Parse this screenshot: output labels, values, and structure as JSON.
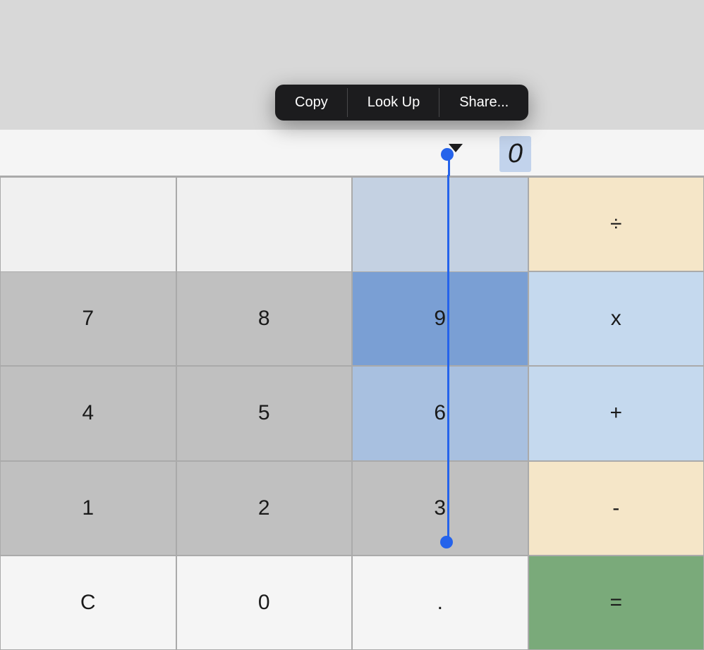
{
  "contextMenu": {
    "items": [
      {
        "id": "copy",
        "label": "Copy"
      },
      {
        "id": "lookup",
        "label": "Look Up"
      },
      {
        "id": "share",
        "label": "Share..."
      }
    ]
  },
  "display": {
    "value": "0"
  },
  "calculator": {
    "rows": [
      [
        {
          "id": "7",
          "label": "7",
          "type": "number"
        },
        {
          "id": "8",
          "label": "8",
          "type": "number"
        },
        {
          "id": "9",
          "label": "9",
          "type": "selected"
        },
        {
          "id": "multiply",
          "label": "x",
          "type": "operator-selected"
        }
      ],
      [
        {
          "id": "4",
          "label": "4",
          "type": "number"
        },
        {
          "id": "5",
          "label": "5",
          "type": "number"
        },
        {
          "id": "6",
          "label": "6",
          "type": "selected-light"
        },
        {
          "id": "add",
          "label": "+",
          "type": "operator-selected"
        }
      ],
      [
        {
          "id": "1",
          "label": "1",
          "type": "number"
        },
        {
          "id": "2",
          "label": "2",
          "type": "number"
        },
        {
          "id": "3",
          "label": "3",
          "type": "number"
        },
        {
          "id": "subtract",
          "label": "-",
          "type": "operator"
        }
      ],
      [
        {
          "id": "clear",
          "label": "C",
          "type": "white"
        },
        {
          "id": "0",
          "label": "0",
          "type": "white"
        },
        {
          "id": "decimal",
          "label": ".",
          "type": "white"
        },
        {
          "id": "equals",
          "label": "=",
          "type": "equals"
        }
      ]
    ],
    "divideLabel": "÷"
  }
}
